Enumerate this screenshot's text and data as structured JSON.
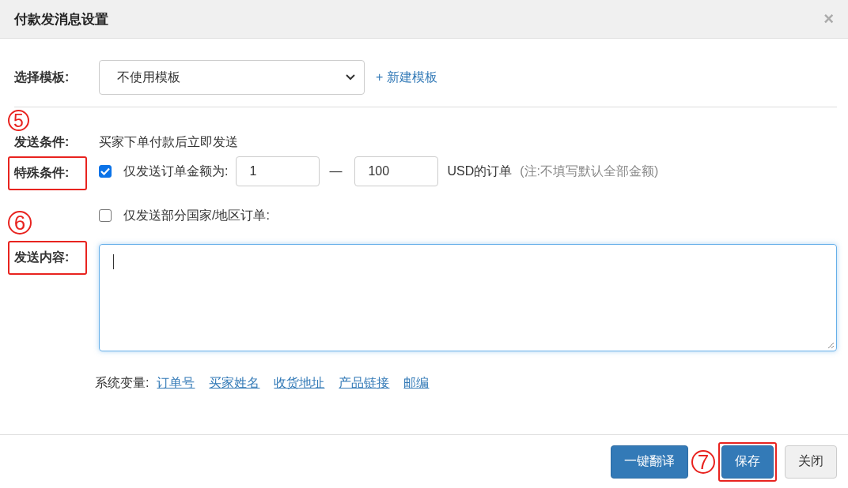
{
  "window": {
    "title": "付款发消息设置",
    "close": "×"
  },
  "template": {
    "label": "选择模板:",
    "value": "不使用模板",
    "link": "+ 新建模板"
  },
  "condition": {
    "label": "发送条件:",
    "text": "买家下单付款后立即发送",
    "highlighted": false,
    "marker": "5"
  },
  "special": {
    "label": "特殊条件:",
    "highlighted": true,
    "options": [
      {
        "kind": "amount",
        "checked": true,
        "text": "仅发送订单金额为:",
        "min": "1",
        "dash": "—",
        "max": "100",
        "suffix": "USD的订单",
        "note": "(注:不填写默认全部金额)"
      },
      {
        "kind": "plain",
        "checked": false,
        "text": "仅发送部分国家/地区订单:"
      }
    ]
  },
  "content": {
    "label": "发送内容:",
    "highlighted": true,
    "marker": "6"
  },
  "variables": {
    "label": "系统变量:",
    "items": [
      "订单号",
      "买家姓名",
      "收货地址",
      "产品链接",
      "邮编"
    ]
  },
  "buttons": [
    {
      "label": "一键翻译",
      "kind": "primary",
      "highlighted": false
    },
    {
      "label": "保存",
      "kind": "primary",
      "highlighted": true,
      "marker": "7"
    },
    {
      "label": "关闭",
      "kind": "default",
      "highlighted": false
    }
  ]
}
